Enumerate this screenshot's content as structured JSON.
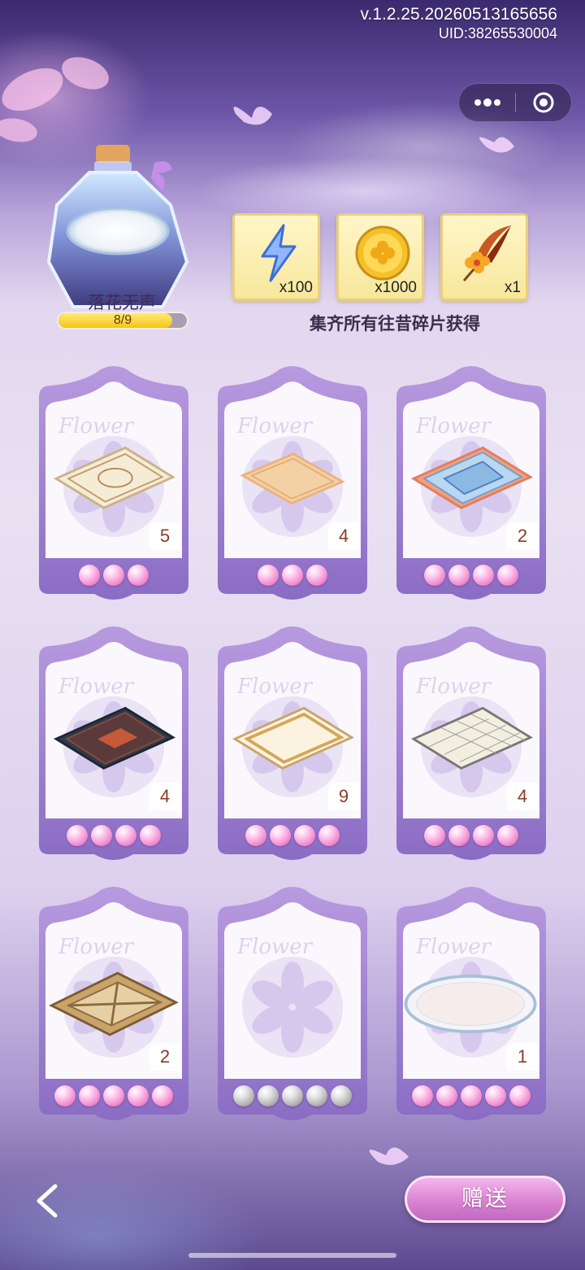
{
  "header": {
    "version": "v.1.2.25.20260513165656",
    "uid": "UID:38265530004",
    "more_icon": "more-dots-icon",
    "target_icon": "target-circle-icon"
  },
  "collection": {
    "name": "落花无声",
    "progress_text": "8/9",
    "progress_fraction": 0.889
  },
  "rewards": {
    "items": [
      {
        "icon": "lightning-energy-icon",
        "count": "x100"
      },
      {
        "icon": "gold-coin-icon",
        "count": "x1000"
      },
      {
        "icon": "flower-hairpin-icon",
        "count": "x1"
      }
    ],
    "caption": "集齐所有往昔碎片获得"
  },
  "cards": [
    {
      "icon": "rug-ornate-cream",
      "count": "5",
      "pearls": 3,
      "pearl_color": "pink"
    },
    {
      "icon": "rug-plain-peach",
      "count": "4",
      "pearls": 3,
      "pearl_color": "pink"
    },
    {
      "icon": "rug-blue-mosaic",
      "count": "2",
      "pearls": 4,
      "pearl_color": "pink"
    },
    {
      "icon": "rug-persian-dark",
      "count": "4",
      "pearls": 4,
      "pearl_color": "pink"
    },
    {
      "icon": "rug-gold-border",
      "count": "9",
      "pearls": 4,
      "pearl_color": "pink"
    },
    {
      "icon": "rug-grid-cream",
      "count": "4",
      "pearls": 4,
      "pearl_color": "pink"
    },
    {
      "icon": "rug-wood-panels",
      "count": "2",
      "pearls": 5,
      "pearl_color": "pink"
    },
    {
      "icon": "locked-empty",
      "count": "",
      "pearls": 5,
      "pearl_color": "gray"
    },
    {
      "icon": "rug-round-floral",
      "count": "1",
      "pearls": 5,
      "pearl_color": "pink"
    }
  ],
  "card_watermark": "Flower",
  "footer": {
    "back_icon": "back-arrow-icon",
    "gift_label": "赠送"
  }
}
